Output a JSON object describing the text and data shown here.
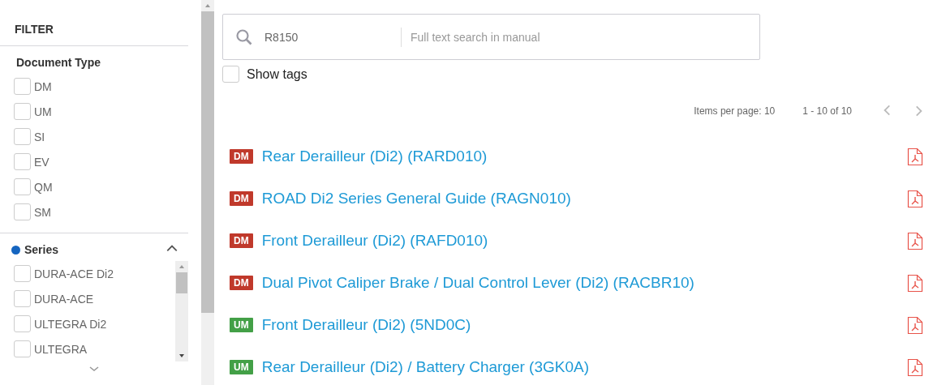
{
  "filter": {
    "title": "FILTER",
    "sections": [
      {
        "title": "Document Type",
        "highlighted": false,
        "items": [
          {
            "label": "DM",
            "checked": false
          },
          {
            "label": "UM",
            "checked": false
          },
          {
            "label": "SI",
            "checked": false
          },
          {
            "label": "EV",
            "checked": false
          },
          {
            "label": "QM",
            "checked": false
          },
          {
            "label": "SM",
            "checked": false
          }
        ]
      },
      {
        "title": "Series",
        "highlighted": true,
        "collapsible": true,
        "expanded": true,
        "scrollable": true,
        "items": [
          {
            "label": "DURA-ACE Di2",
            "checked": false
          },
          {
            "label": "DURA-ACE",
            "checked": false
          },
          {
            "label": "ULTEGRA Di2",
            "checked": false
          },
          {
            "label": "ULTEGRA",
            "checked": false
          }
        ]
      }
    ]
  },
  "search": {
    "value": "R8150",
    "placeholder": "Full text search in manual"
  },
  "show_tags": {
    "label": "Show tags",
    "checked": false
  },
  "pagination": {
    "items_per_page": "Items per page: 10",
    "range": "1 - 10 of 10",
    "prev_disabled": true,
    "next_disabled": true
  },
  "documents": [
    {
      "type": "DM",
      "color": "#c0392b",
      "title": "Rear Derailleur (Di2) (RARD010)"
    },
    {
      "type": "DM",
      "color": "#c0392b",
      "title": "ROAD Di2 Series General Guide (RAGN010)"
    },
    {
      "type": "DM",
      "color": "#c0392b",
      "title": "Front Derailleur (Di2) (RAFD010)"
    },
    {
      "type": "DM",
      "color": "#c0392b",
      "title": "Dual Pivot Caliper Brake / Dual Control Lever (Di2) (RACBR10)"
    },
    {
      "type": "UM",
      "color": "#43a047",
      "title": "Front Derailleur (Di2) (5ND0C)"
    },
    {
      "type": "UM",
      "color": "#43a047",
      "title": "Rear Derailleur (Di2) / Battery Charger (3GK0A)"
    }
  ]
}
